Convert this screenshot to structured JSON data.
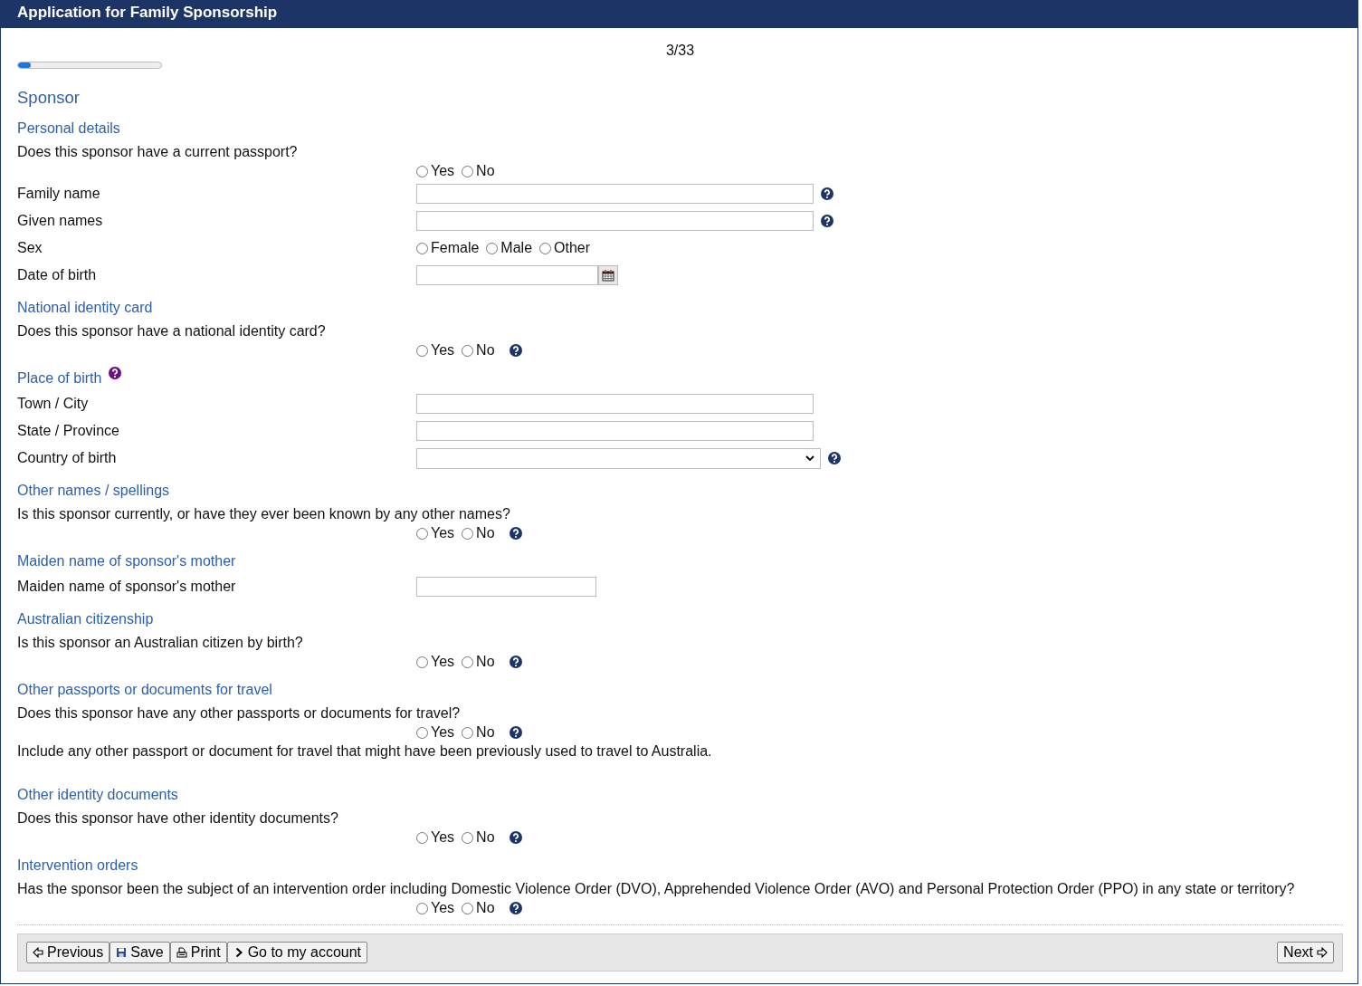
{
  "window": {
    "title": "Application for Family Sponsorship"
  },
  "progress": {
    "reading": "3/33",
    "level": 0.09
  },
  "page_heading": "Sponsor",
  "sections": [
    {
      "title": "Personal details",
      "help": false,
      "items": [
        {
          "kind": "question",
          "label": "Does this sponsor have a current passport?",
          "help": false,
          "options": [
            {
              "label": "Yes",
              "selected": false
            },
            {
              "label": "No",
              "selected": false
            }
          ]
        },
        {
          "kind": "text",
          "label": "Family name",
          "help": true
        },
        {
          "kind": "text",
          "label": "Given names",
          "help": true
        },
        {
          "kind": "radio",
          "label": "Sex",
          "help": false,
          "options": [
            {
              "label": "Female",
              "selected": false
            },
            {
              "label": "Male",
              "selected": false
            },
            {
              "label": "Other",
              "selected": false
            }
          ]
        },
        {
          "kind": "date",
          "label": "Date of birth",
          "help": false
        }
      ]
    },
    {
      "title": "National identity card",
      "help": false,
      "items": [
        {
          "kind": "question",
          "label": "Does this sponsor have a national identity card?",
          "help": true,
          "options": [
            {
              "label": "Yes",
              "selected": false
            },
            {
              "label": "No",
              "selected": false
            }
          ]
        }
      ]
    },
    {
      "title": "Place of birth",
      "help": true,
      "items": [
        {
          "kind": "text",
          "label": "Town / City",
          "help": false
        },
        {
          "kind": "text",
          "label": "State / Province",
          "help": false
        },
        {
          "kind": "select",
          "label": "Country of birth",
          "help": true
        }
      ]
    },
    {
      "title": "Other names / spellings",
      "help": false,
      "items": [
        {
          "kind": "question",
          "label": "Is this sponsor currently, or have they ever been known by any other names?",
          "help": true,
          "options": [
            {
              "label": "Yes",
              "selected": false
            },
            {
              "label": "No",
              "selected": false
            }
          ]
        }
      ]
    },
    {
      "title": "Maiden name of sponsor's mother",
      "help": false,
      "items": [
        {
          "kind": "short_text",
          "label": "Maiden name of sponsor's mother",
          "help": false
        }
      ]
    },
    {
      "title": "Australian citizenship",
      "help": false,
      "items": [
        {
          "kind": "question",
          "label": "Is this sponsor an Australian citizen by birth?",
          "help": true,
          "options": [
            {
              "label": "Yes",
              "selected": false
            },
            {
              "label": "No",
              "selected": false
            }
          ]
        }
      ]
    },
    {
      "title": "Other passports or documents for travel",
      "help": false,
      "items": [
        {
          "kind": "question",
          "label": "Does this sponsor have any other passports or documents for travel?",
          "help": true,
          "options": [
            {
              "label": "Yes",
              "selected": false
            },
            {
              "label": "No",
              "selected": false
            }
          ]
        },
        {
          "kind": "note",
          "label": "Include any other passport or document for travel that might have been previously used to travel to Australia."
        }
      ]
    },
    {
      "title": "Other identity documents",
      "help": false,
      "items": [
        {
          "kind": "question",
          "label": "Does this sponsor have other identity documents?",
          "help": true,
          "options": [
            {
              "label": "Yes",
              "selected": false
            },
            {
              "label": "No",
              "selected": false
            }
          ]
        }
      ]
    },
    {
      "title": "Intervention orders",
      "help": false,
      "items": [
        {
          "kind": "question",
          "label": "Has the sponsor been the subject of an intervention order including Domestic Violence Order (DVO), Apprehended Violence Order (AVO) and Personal Protection Order (PPO) in any state or territory?",
          "help": true,
          "options": [
            {
              "label": "Yes",
              "selected": false
            },
            {
              "label": "No",
              "selected": false
            }
          ]
        }
      ]
    }
  ],
  "buttons_left": [
    {
      "label": "Previous",
      "kind": "back"
    },
    {
      "label": "Save",
      "kind": "save"
    },
    {
      "label": "Print",
      "kind": "print"
    },
    {
      "label": "Go to my account",
      "kind": "go"
    }
  ],
  "buttons_right": [
    {
      "label": "Next",
      "kind": "next"
    }
  ]
}
